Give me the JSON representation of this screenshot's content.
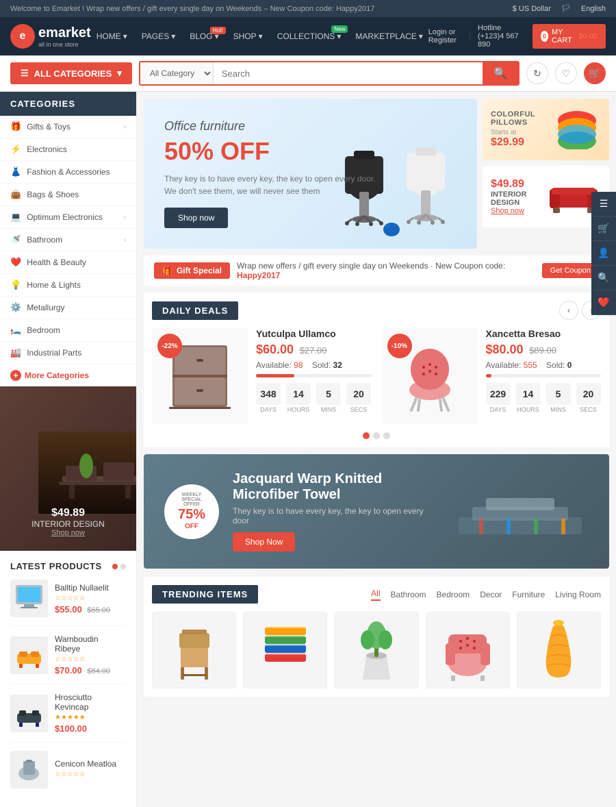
{
  "topbar": {
    "message": "Welcome to Emarket ! Wrap new offers / gift every single day on Weekends – New Coupon code: Happy2017",
    "currency": "$ US Dollar",
    "language": "English"
  },
  "header": {
    "logo_letter": "e",
    "logo_name": "emarket",
    "logo_sub": "all in one store",
    "nav": [
      {
        "label": "HOME",
        "badge": null
      },
      {
        "label": "PAGES",
        "badge": null
      },
      {
        "label": "BLOG",
        "badge": null
      },
      {
        "label": "SHOP",
        "badge": null
      },
      {
        "label": "COLLECTIONS",
        "badge": "New"
      },
      {
        "label": "MARKETPLACE",
        "badge": null
      }
    ],
    "login_label": "Login or Register",
    "hotline_label": "Hotline (+123)4 567 890",
    "cart_label": "MY CART",
    "cart_price": "$0.00",
    "cart_count": "0"
  },
  "searchbar": {
    "all_categories_label": "ALL CATEGORIES",
    "category_placeholder": "All Category",
    "search_placeholder": "Search"
  },
  "categories_title": "CATEGORIES",
  "sidebar_items": [
    {
      "icon": "🎁",
      "label": "Gifts & Toys",
      "has_arrow": true
    },
    {
      "icon": "⚡",
      "label": "Electronics",
      "has_arrow": false
    },
    {
      "icon": "👗",
      "label": "Fashion & Accessories",
      "has_arrow": false
    },
    {
      "icon": "👜",
      "label": "Bags & Shoes",
      "has_arrow": false
    },
    {
      "icon": "💻",
      "label": "Optimum Electronics",
      "has_arrow": true
    },
    {
      "icon": "🚿",
      "label": "Bathroom",
      "has_arrow": true
    },
    {
      "icon": "❤️",
      "label": "Health & Beauty",
      "has_arrow": false
    },
    {
      "icon": "💡",
      "label": "Home & Lights",
      "has_arrow": false
    },
    {
      "icon": "⚙️",
      "label": "Metallurgy",
      "has_arrow": false
    },
    {
      "icon": "🛏️",
      "label": "Bedroom",
      "has_arrow": false
    },
    {
      "icon": "🏭",
      "label": "Industrial Parts",
      "has_arrow": false
    }
  ],
  "more_categories_label": "More Categories",
  "sidebar_banner": {
    "price": "$49.89",
    "title": "INTERIOR DESIGN",
    "link": "Shop now"
  },
  "latest_products": {
    "title": "LATEST PRODUCTS",
    "items": [
      {
        "name": "Balltip Nullaelit",
        "price_new": "$55.00",
        "price_old": "$65.00",
        "color": "#4fc3f7"
      },
      {
        "name": "Wamboudin Ribeye",
        "price_new": "$70.00",
        "price_old": "$84.00",
        "color": "#f9a825"
      },
      {
        "name": "Hrosciutto Kevincap",
        "price_new": "$100.00",
        "price_old": null,
        "color": "#37474f"
      },
      {
        "name": "Cenicon Meatloa",
        "price_new": null,
        "price_old": null,
        "color": "#e0e0e0"
      }
    ]
  },
  "hero": {
    "subtitle": "Office furniture",
    "title": "50% OFF",
    "desc": "They key is to have every key, the key to open every door.\nWe don't see them, we will never see them",
    "btn_label": "Shop now"
  },
  "hero_cards": [
    {
      "label": "COLORFUL PILLOWS",
      "starts_text": "Starts at",
      "price": "$29.99"
    },
    {
      "price": "$49.89",
      "title": "INTERIOR DESIGN",
      "link": "Shop now"
    }
  ],
  "gift_bar": {
    "icon": "🎁",
    "label": "Gift Special",
    "text": "Wrap new offers / gift every single day on Weekends · New Coupon code:",
    "highlight": "Happy2017",
    "btn_label": "Get Coupon"
  },
  "daily_deals": {
    "title": "DAILY DEALS",
    "items": [
      {
        "name": "Yutculpa Ullamco",
        "price_new": "$60.00",
        "price_old": "$27.00",
        "badge": "-22%",
        "available": 98,
        "sold": 32,
        "progress": 33,
        "days": 348,
        "hours": 14,
        "mins": 5,
        "secs": 20
      },
      {
        "name": "Xancetta Bresao",
        "price_new": "$80.00",
        "price_old": "$89.00",
        "badge": "-10%",
        "available": 555,
        "sold": 0,
        "progress": 5,
        "days": 229,
        "hours": 14,
        "mins": 5,
        "secs": 20
      }
    ]
  },
  "weekly_special": {
    "pct": "75%",
    "off": "OFF",
    "label": "WEEKLY SPECIAL OFFER",
    "title": "Jacquard Warp Knitted Microfiber Towel",
    "desc": "They key is to have every key, the key to open every door",
    "btn_label": "Shop Now"
  },
  "trending": {
    "title": "TRENDING ITEMS",
    "tabs": [
      "All",
      "Bathroom",
      "Bedroom",
      "Decor",
      "Furniture",
      "Living Room"
    ],
    "active_tab": 0
  },
  "labels": {
    "available": "Available:",
    "sold": "Sold:",
    "days": "DAYS",
    "hours": "HOURS",
    "mins": "MINS",
    "secs": "SECS",
    "collections_label": "COLLECTIONS"
  }
}
